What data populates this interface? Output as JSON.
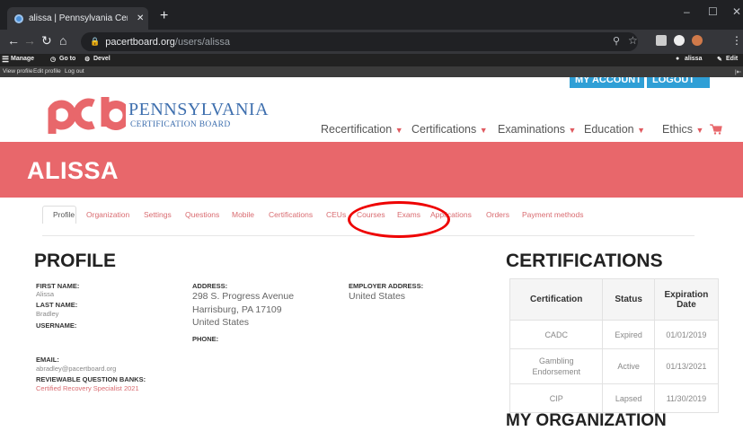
{
  "browser": {
    "tab_title": "alissa | Pennsylvania Certification",
    "tab_close": "✕",
    "new_tab": "+",
    "url_host": "pacertboard.org",
    "url_path": "/users/alissa",
    "minimize": "–",
    "maximize": "☐",
    "close": "✕"
  },
  "admin_bar": {
    "manage": "Manage",
    "goto": "Go to",
    "devel": "Devel",
    "user": "alissa",
    "edit": "Edit",
    "view_profile": "View profile",
    "edit_profile": "Edit profile",
    "log_out": "Log out"
  },
  "header": {
    "my_account": "MY ACCOUNT",
    "logout": "LOGOUT",
    "logo_name": "PENNSYLVANIA",
    "logo_sub": "CERTIFICATION BOARD",
    "nav": [
      "Recertification",
      "Certifications",
      "Examinations",
      "Education",
      "Ethics"
    ]
  },
  "page_title": "ALISSA",
  "subnav": [
    "Profile",
    "Organization",
    "Settings",
    "Questions",
    "Mobile",
    "Certifications",
    "CEUs",
    "Courses",
    "Exams",
    "Applications",
    "Orders",
    "Payment methods"
  ],
  "profile": {
    "heading": "PROFILE",
    "first_name_label": "FIRST NAME:",
    "first_name": "Alissa",
    "last_name_label": "LAST NAME:",
    "last_name": "Bradley",
    "username_label": "USERNAME:",
    "email_label": "EMAIL:",
    "email": "abradley@pacertboard.org",
    "rqb_label": "REVIEWABLE QUESTION BANKS:",
    "rqb_value": "Certified Recovery Specialist 2021",
    "address_label": "ADDRESS:",
    "address_line1": "298 S. Progress Avenue",
    "address_line2": "Harrisburg, PA 17109",
    "address_line3": "United States",
    "phone_label": "PHONE:",
    "employer_label": "EMPLOYER ADDRESS:",
    "employer_value": "United States"
  },
  "certifications": {
    "heading": "CERTIFICATIONS",
    "columns": [
      "Certification",
      "Status",
      "Expiration Date"
    ],
    "rows": [
      {
        "name": "CADC",
        "status": "Expired",
        "date": "01/01/2019"
      },
      {
        "name": "Gambling Endorsement",
        "status": "Active",
        "date": "01/13/2021"
      },
      {
        "name": "CIP",
        "status": "Lapsed",
        "date": "11/30/2019"
      }
    ]
  },
  "my_org_heading": "MY ORGANIZATION",
  "colors": {
    "banner": "#e8676b",
    "accent_link": "#d96b70",
    "logo_blue": "#3e6fae",
    "annotation_circle": "#ee0000"
  }
}
